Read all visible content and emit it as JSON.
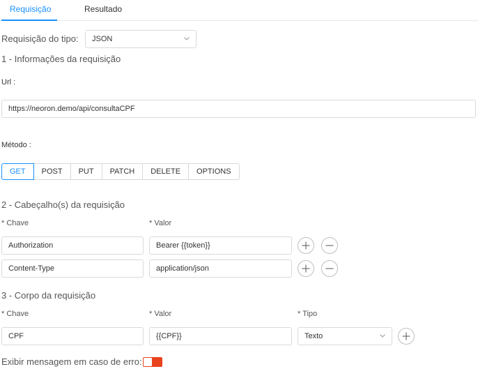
{
  "tabs": [
    {
      "label": "Requisição",
      "active": true
    },
    {
      "label": "Resultado",
      "active": false
    }
  ],
  "request_type": {
    "label": "Requisição do tipo:",
    "value": "JSON"
  },
  "section1": {
    "title": "1 - Informações da requisição",
    "url_label": "Url",
    "url_value": "https://neoron.demo/api/consultaCPF",
    "method_label": "Método",
    "methods": [
      "GET",
      "POST",
      "PUT",
      "PATCH",
      "DELETE",
      "OPTIONS"
    ],
    "selected_method": "GET"
  },
  "section2": {
    "title": "2 - Cabeçalho(s) da requisição",
    "key_label": "* Chave",
    "value_label": "* Valor",
    "rows": [
      {
        "key": "Authorization",
        "value": "Bearer {{token}}"
      },
      {
        "key": "Content-Type",
        "value": "application/json"
      }
    ]
  },
  "section3": {
    "title": "3 - Corpo da requisição",
    "key_label": "* Chave",
    "value_label": "* Valor",
    "type_label": "* Tipo",
    "rows": [
      {
        "key": "CPF",
        "value": "{{CPF}}",
        "type": "Texto"
      }
    ]
  },
  "error_message": {
    "label": "Exibir mensagem em caso de erro:",
    "enabled": false
  },
  "colors": {
    "accent": "#1890ff",
    "toggle_off": "#e8431f",
    "border": "#d9d9d9"
  }
}
